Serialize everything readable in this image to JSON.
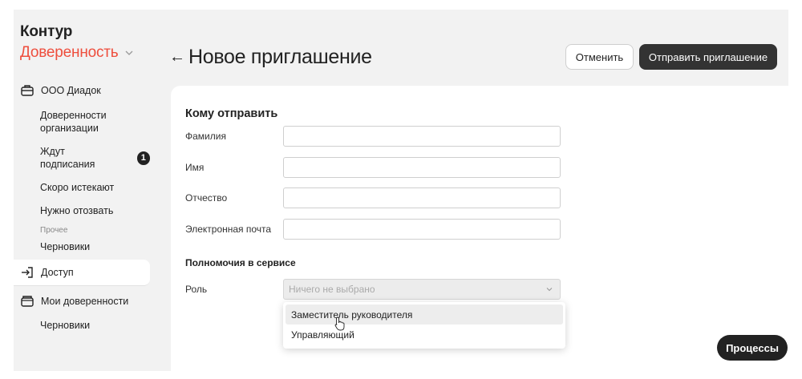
{
  "brand": {
    "name": "Контур",
    "product": "Доверенность"
  },
  "sidebar": {
    "org": "ООО Диадок",
    "items": [
      {
        "label": "Доверенности организации"
      },
      {
        "label": "Ждут подписания",
        "badge": "1"
      },
      {
        "label": "Скоро истекают"
      },
      {
        "label": "Нужно отозвать"
      }
    ],
    "section_label": "Прочее",
    "other_items": [
      {
        "label": "Черновики"
      }
    ],
    "access": "Доступ",
    "my_docs": "Мои доверенности",
    "my_drafts": "Черновики"
  },
  "header": {
    "title": "Новое приглашение",
    "cancel_label": "Отменить",
    "send_label": "Отправить приглашение"
  },
  "form": {
    "section_title": "Кому отправить",
    "fields": [
      {
        "label": "Фамилия",
        "value": ""
      },
      {
        "label": "Имя",
        "value": ""
      },
      {
        "label": "Отчество",
        "value": ""
      },
      {
        "label": "Электронная почта",
        "value": ""
      }
    ],
    "permissions_title": "Полномочия в сервисе",
    "role_label": "Роль",
    "role_placeholder": "Ничего не выбрано",
    "role_options": [
      "Заместитель руководителя",
      "Управляющий"
    ]
  },
  "processes_label": "Процессы",
  "colors": {
    "brand_accent": "#ee4e3d",
    "primary_button": "#333333"
  }
}
